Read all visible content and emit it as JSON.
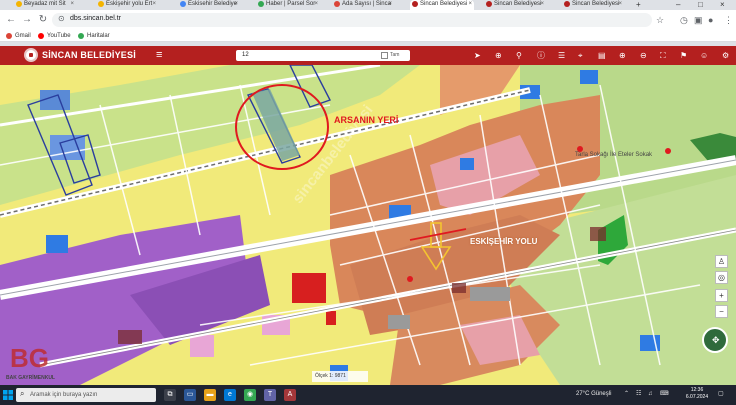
{
  "browser": {
    "tabs": [
      {
        "label": "Beyadaz mit Sit",
        "color": "#f4b400"
      },
      {
        "label": "Eskişehir yolu Ert",
        "color": "#f4b400"
      },
      {
        "label": "Eskisehir Belediye",
        "color": "#4285f4"
      },
      {
        "label": "Haber | Parsel Sor",
        "color": "#34a853"
      },
      {
        "label": "Ada Sayısı | Sinca",
        "color": "#db4437"
      },
      {
        "label": "Sincan Belediyesi",
        "color": "#b4201f"
      },
      {
        "label": "Sincan Belediyesi",
        "color": "#b4201f"
      },
      {
        "label": "Sincan Belediyesi",
        "color": "#b4201f"
      }
    ],
    "new_tab": "+",
    "url": "dbs.sincan.bel.tr",
    "bookmarks": [
      {
        "label": "Gmail",
        "color": "#db4437"
      },
      {
        "label": "YouTube",
        "color": "#ff0000"
      },
      {
        "label": "Haritalar",
        "color": "#34a853"
      }
    ]
  },
  "app": {
    "brand": "SİNCAN BELEDİYESİ",
    "search_value": "12",
    "search_filter_label": "Tam",
    "accent": "#b4201f"
  },
  "map": {
    "annotation_arsa": "ARSANIN YERİ",
    "annotation_yol": "ESKİŞEHİR YOLU",
    "place_label": "Tarla Sokağı İle Eteler Sokak",
    "scale_text": "Ölçek 1: 9871",
    "watermark_text": "BAK GAYRİMENKUL",
    "watermark_mark": "BG"
  },
  "taskbar": {
    "search_placeholder": "Aramak için buraya yazın",
    "weather": "27°C Güneşli",
    "time": "12:36",
    "date": "6.07.2024"
  }
}
